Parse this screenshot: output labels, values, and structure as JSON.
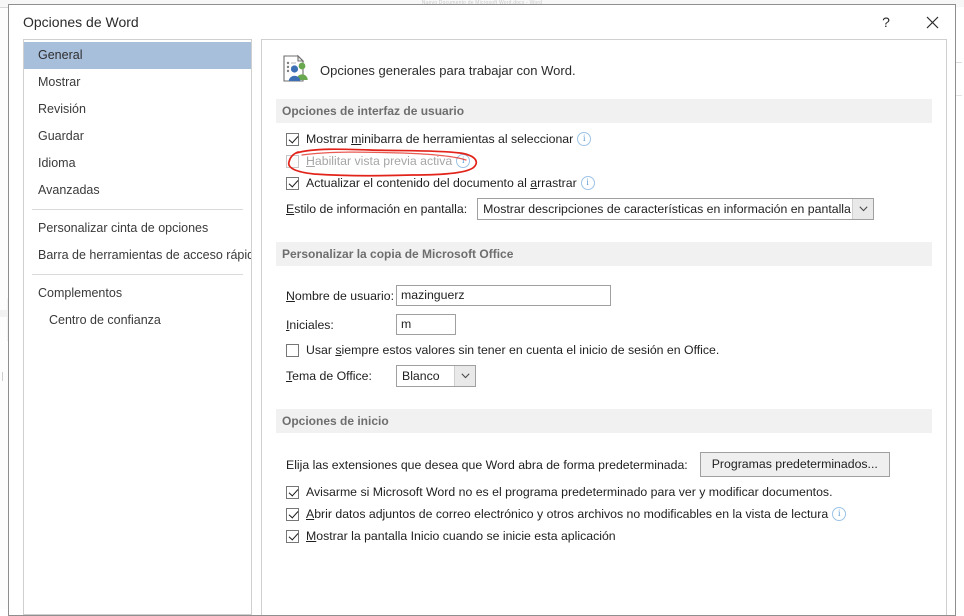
{
  "background": {
    "word_titlebar_text": "Nuevo Documento de Microsoft Word.docx - Word"
  },
  "dialog": {
    "title": "Opciones de Word",
    "caption_buttons": [
      {
        "name": "help-button",
        "glyph": "?"
      },
      {
        "name": "close-button",
        "glyph": "✕"
      }
    ]
  },
  "sidebar": {
    "items": [
      {
        "label": "General",
        "selected": true
      },
      {
        "label": "Mostrar",
        "selected": false
      },
      {
        "label": "Revisión",
        "selected": false
      },
      {
        "label": "Guardar",
        "selected": false
      },
      {
        "label": "Idioma",
        "selected": false
      },
      {
        "label": "Avanzadas",
        "selected": false
      },
      {
        "label": "Personalizar cinta de opciones",
        "selected": false
      },
      {
        "label": "Barra de herramientas de acceso rápido",
        "selected": false
      },
      {
        "label": "Complementos",
        "selected": false
      },
      {
        "label": "Centro de confianza",
        "selected": false
      }
    ]
  },
  "pane": {
    "header": {
      "icon": "general-options-document-people-icon",
      "text": "Opciones generales para trabajar con Word."
    },
    "sections": {
      "ui_options": {
        "title": "Opciones de interfaz de usuario",
        "checkbox_minibar": {
          "label_pre": "Mostrar ",
          "label_key": "m",
          "label_post": "inibarra de herramientas al seleccionar",
          "checked": true,
          "info": "ⓘ"
        },
        "checkbox_live_preview": {
          "label_pre": "",
          "label_key": "H",
          "label_post": "abilitar vista previa activa",
          "checked": false,
          "disabled": true,
          "annotated": true,
          "info": "ⓘ"
        },
        "checkbox_drag_update": {
          "label_pre": "Actualizar el contenido del documento al ",
          "label_key": "a",
          "label_post": "rrastrar",
          "checked": true,
          "info": "ⓘ"
        },
        "screentip_label_key": "E",
        "screentip_label_rest": "stilo de información en pantalla:",
        "screentip_value": "Mostrar descripciones de características en información en pantalla"
      },
      "personalize": {
        "title": "Personalizar la copia de Microsoft Office",
        "username_label_key": "N",
        "username_label_rest": "ombre de usuario:",
        "username_value": "mazinguerz",
        "initials_label_key": "I",
        "initials_label_rest": "niciales:",
        "initials_value": "m",
        "always_use_label_pre": "Usar ",
        "always_use_label_key": "s",
        "always_use_label_post": "iempre estos valores sin tener en cuenta el inicio de sesión en Office.",
        "always_use_checked": false,
        "theme_label_key": "T",
        "theme_label_rest": "ema de Office:",
        "theme_value": "Blanco"
      },
      "startup": {
        "title": "Opciones de inicio",
        "extensions_label": "Elija las extensiones que desea que Word abra de forma predeterminada:",
        "default_programs_button": "Programas predeterminados...",
        "checkbox_notify_default": {
          "label": "Avisarme si Microsoft Word no es el programa predeterminado para ver y modificar documentos.",
          "checked": true
        },
        "checkbox_open_attachments": {
          "label_key": "A",
          "label_rest": "brir datos adjuntos de correo electrónico y otros archivos no modificables en la vista de lectura",
          "checked": true,
          "info": "ⓘ"
        },
        "checkbox_show_start_screen": {
          "label_key": "M",
          "label_rest": "ostrar la pantalla Inicio cuando se inicie esta aplicación",
          "checked": true
        }
      }
    }
  },
  "annotation": {
    "type": "hand-drawn-red-ellipse",
    "color": "#e2231a",
    "target": "Habilitar vista previa activa"
  },
  "colors": {
    "selection_blue": "#a8bfdc",
    "section_band": "#f1f1f1",
    "section_text": "#6e6e6e",
    "annotation_red": "#e2231a",
    "info_icon_blue": "#5b9bd5"
  }
}
